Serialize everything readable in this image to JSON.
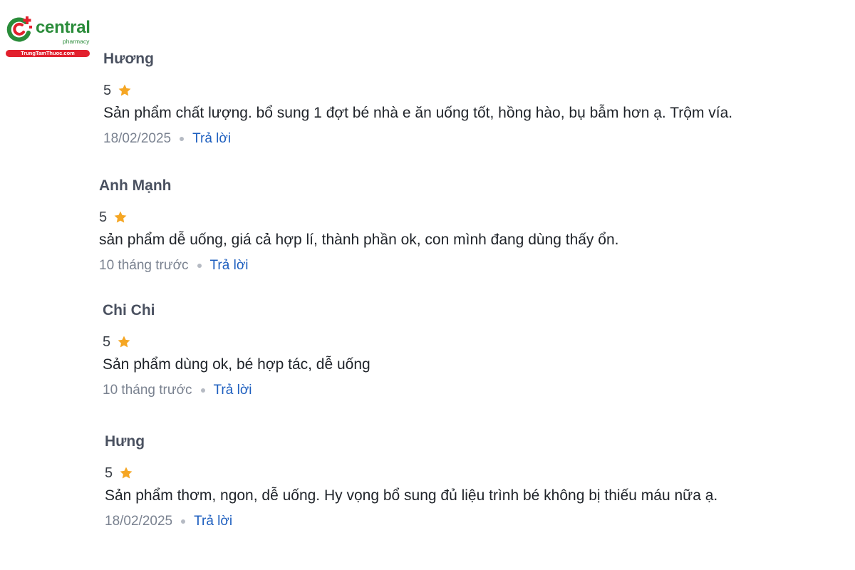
{
  "logo": {
    "brand": "central",
    "sub": "pharmacy",
    "url": "TrungTamThuoc.com"
  },
  "colors": {
    "brand_green": "#2a8c3a",
    "brand_red": "#e2202d",
    "star": "#f5a623",
    "link": "#1e5fbf"
  },
  "reviews": [
    {
      "name": "Hương",
      "rating": "5",
      "icon": "star-icon",
      "text": "Sản phẩm chất lượng. bổ sung 1 đợt bé nhà e ăn uống tốt, hồng hào, bụ bẫm hơn ạ. Trộm vía.",
      "date": "18/02/2025",
      "reply_label": "Trả lời"
    },
    {
      "name": "Anh Mạnh",
      "rating": "5",
      "icon": "star-icon",
      "text": "sản phẩm dễ uống, giá cả hợp lí, thành phần ok, con mình đang dùng thấy ổn.",
      "date": "10 tháng trước",
      "reply_label": "Trả lời"
    },
    {
      "name": "Chi Chi",
      "rating": "5",
      "icon": "star-icon",
      "text": "Sản phẩm dùng ok, bé hợp tác, dễ uống",
      "date": "10 tháng trước",
      "reply_label": "Trả lời"
    },
    {
      "name": "Hưng",
      "rating": "5",
      "icon": "star-icon",
      "text": "Sản phẩm thơm, ngon, dễ uống. Hy vọng bổ sung đủ liệu trình bé không bị thiếu máu nữa ạ.",
      "date": "18/02/2025",
      "reply_label": "Trả lời"
    }
  ]
}
